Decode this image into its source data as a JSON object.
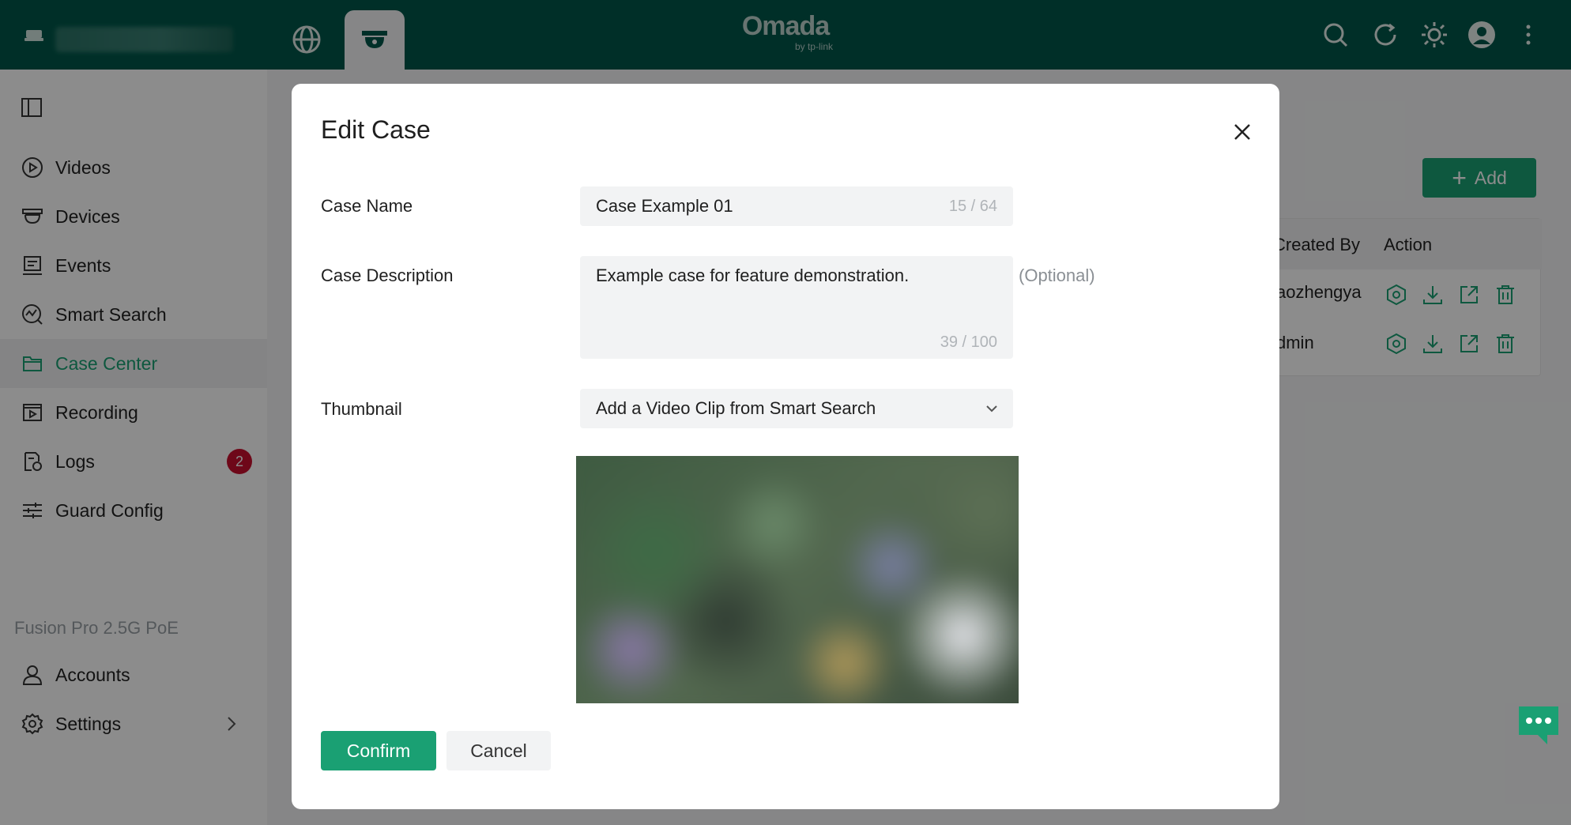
{
  "topbar": {
    "logo_brand": "Omada",
    "logo_sub": "by tp-link",
    "icons": [
      "device-icon",
      "globe-icon",
      "camera-icon",
      "search-icon",
      "refresh-icon",
      "theme-icon",
      "avatar",
      "more-icon"
    ]
  },
  "sidebar": {
    "items": [
      {
        "label": "Videos",
        "icon": "play-circle-icon"
      },
      {
        "label": "Devices",
        "icon": "camera-icon"
      },
      {
        "label": "Events",
        "icon": "events-icon"
      },
      {
        "label": "Smart Search",
        "icon": "smart-search-icon"
      },
      {
        "label": "Case Center",
        "icon": "folder-icon",
        "active": true
      },
      {
        "label": "Recording",
        "icon": "recording-icon"
      },
      {
        "label": "Logs",
        "icon": "logs-icon",
        "badge": "2"
      },
      {
        "label": "Guard Config",
        "icon": "sliders-icon"
      }
    ],
    "group_label": "Fusion Pro 2.5G PoE",
    "items2": [
      {
        "label": "Accounts",
        "icon": "user-icon"
      },
      {
        "label": "Settings",
        "icon": "gear-icon"
      }
    ]
  },
  "main": {
    "add_label": "Add",
    "table": {
      "headers": [
        "Created By",
        "Action"
      ],
      "rows": [
        {
          "created_by": "aozhengya"
        },
        {
          "created_by": "dmin"
        }
      ]
    }
  },
  "modal": {
    "title": "Edit Case",
    "case_name_label": "Case Name",
    "case_name_value": "Case Example 01",
    "case_name_count": "15 / 64",
    "case_desc_label": "Case Description",
    "case_desc_value": "Example case for feature demonstration.",
    "case_desc_count": "39 / 100",
    "optional_label": "(Optional)",
    "thumbnail_label": "Thumbnail",
    "thumbnail_select": "Add a Video Clip from Smart Search",
    "confirm_label": "Confirm",
    "cancel_label": "Cancel"
  },
  "colors": {
    "brand_dark": "#00574a",
    "accent": "#1aa073",
    "badge": "#c8102e"
  }
}
